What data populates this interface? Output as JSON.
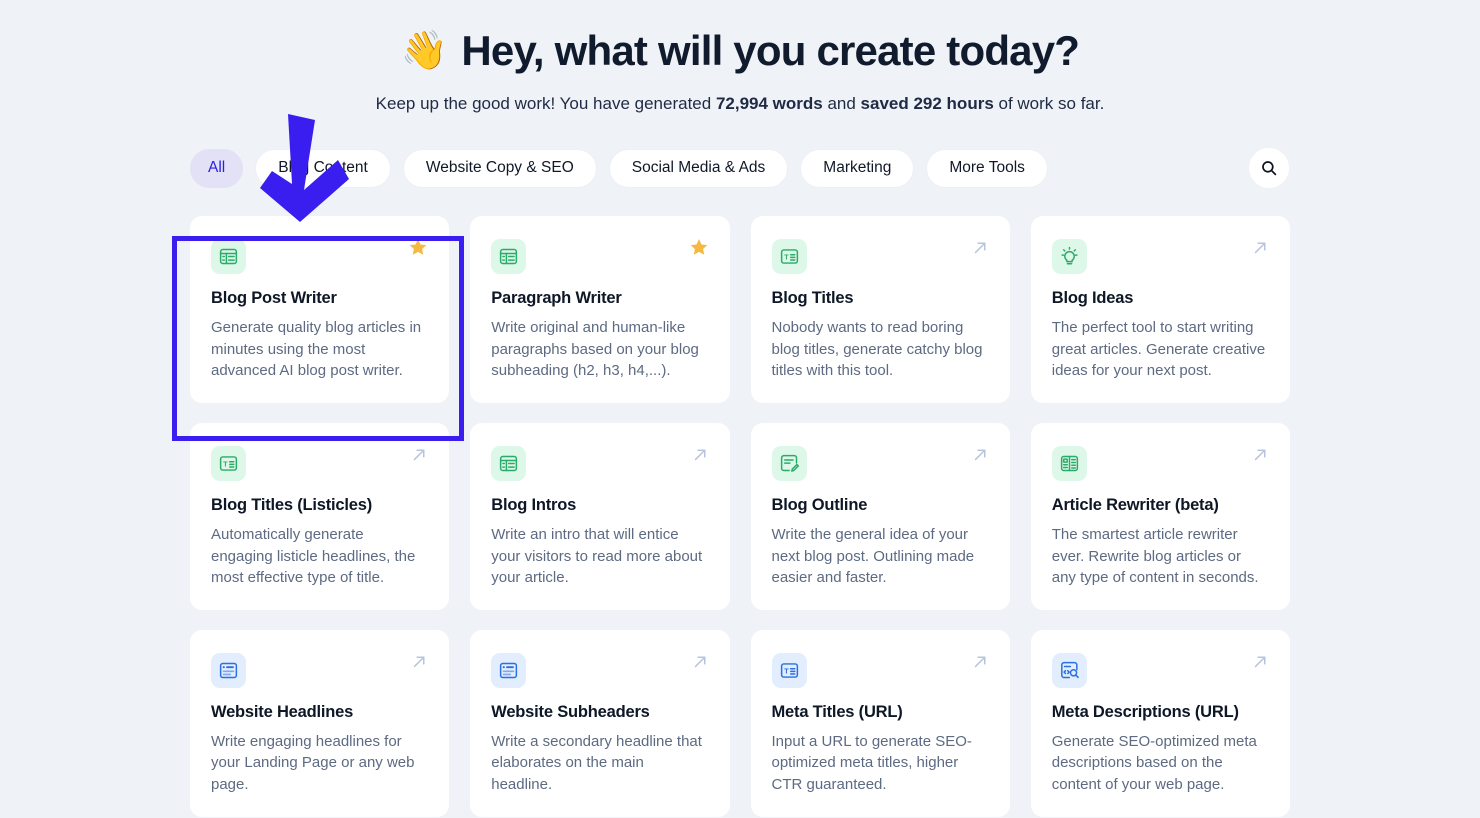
{
  "header": {
    "emoji": "👋",
    "title": "Hey, what will you create today?",
    "subtitle_part1": "Keep up the good work! You have generated ",
    "subtitle_words": "72,994 words",
    "subtitle_part2": " and ",
    "subtitle_hours": "saved 292 hours",
    "subtitle_part3": " of work so far."
  },
  "filters": {
    "chips": [
      {
        "label": "All",
        "active": true
      },
      {
        "label": "Blog Content",
        "active": false
      },
      {
        "label": "Website Copy & SEO",
        "active": false
      },
      {
        "label": "Social Media & Ads",
        "active": false
      },
      {
        "label": "Marketing",
        "active": false
      },
      {
        "label": "More Tools",
        "active": false
      }
    ],
    "search_icon": "search-icon"
  },
  "colors": {
    "page_background": "#eff2f6",
    "accent_blue": "#3a1ef0",
    "chip_active_bg": "#e3e1f5",
    "chip_active_text": "#2b20e0",
    "icon_green": "#2bab6a",
    "icon_green_bg": "#ddf7e8",
    "icon_blue": "#2b6fe0",
    "icon_blue_bg": "#e2edfd",
    "star_gold": "#f5b841",
    "card_bg": "#ffffff",
    "title_text": "#0e1726",
    "desc_text": "#5d6a82"
  },
  "annotations": {
    "arrow_color": "#3a1ef0",
    "arrow_target": "blog-content-chip",
    "highlight_target": "Blog Post Writer"
  },
  "cards": [
    {
      "title": "Blog Post Writer",
      "desc": "Generate quality blog articles in minutes using the most advanced AI blog post writer.",
      "icon": "article-table-icon",
      "icon_color": "green",
      "badge": "star",
      "highlighted": true
    },
    {
      "title": "Paragraph Writer",
      "desc": "Write original and human-like paragraphs based on your blog subheading (h2, h3, h4,...).",
      "icon": "article-table-icon",
      "icon_color": "green",
      "badge": "star",
      "highlighted": false
    },
    {
      "title": "Blog Titles",
      "desc": "Nobody wants to read boring blog titles, generate catchy blog titles with this tool.",
      "icon": "title-box-icon",
      "icon_color": "green",
      "badge": "external-link",
      "highlighted": false
    },
    {
      "title": "Blog Ideas",
      "desc": "The perfect tool to start writing great articles. Generate creative ideas for your next post.",
      "icon": "lightbulb-icon",
      "icon_color": "green",
      "badge": "external-link",
      "highlighted": false
    },
    {
      "title": "Blog Titles (Listicles)",
      "desc": "Automatically generate engaging listicle headlines, the most effective type of title.",
      "icon": "title-box-icon",
      "icon_color": "green",
      "badge": "external-link",
      "highlighted": false
    },
    {
      "title": "Blog Intros",
      "desc": "Write an intro that will entice your visitors to read more about your article.",
      "icon": "article-table-icon",
      "icon_color": "green",
      "badge": "external-link",
      "highlighted": false
    },
    {
      "title": "Blog Outline",
      "desc": "Write the general idea of your next blog post. Outlining made easier and faster.",
      "icon": "note-pencil-icon",
      "icon_color": "green",
      "badge": "external-link",
      "highlighted": false
    },
    {
      "title": "Article Rewriter (beta)",
      "desc": "The smartest article rewriter ever. Rewrite blog articles or any type of content in seconds.",
      "icon": "two-column-icon",
      "icon_color": "green",
      "badge": "external-link",
      "highlighted": false
    },
    {
      "title": "Website Headlines",
      "desc": "Write engaging headlines for your Landing Page or any web page.",
      "icon": "headline-layout-icon",
      "icon_color": "blue",
      "badge": "external-link",
      "highlighted": false
    },
    {
      "title": "Website Subheaders",
      "desc": "Write a secondary headline that elaborates on the main headline.",
      "icon": "headline-layout-icon",
      "icon_color": "blue",
      "badge": "external-link",
      "highlighted": false
    },
    {
      "title": "Meta Titles (URL)",
      "desc": "Input a URL to generate SEO-optimized meta titles, higher CTR guaranteed.",
      "icon": "title-box-icon",
      "icon_color": "blue",
      "badge": "external-link",
      "highlighted": false
    },
    {
      "title": "Meta Descriptions (URL)",
      "desc": "Generate SEO-optimized meta descriptions based on the content of your web page.",
      "icon": "page-search-icon",
      "icon_color": "blue",
      "badge": "external-link",
      "highlighted": false
    }
  ]
}
